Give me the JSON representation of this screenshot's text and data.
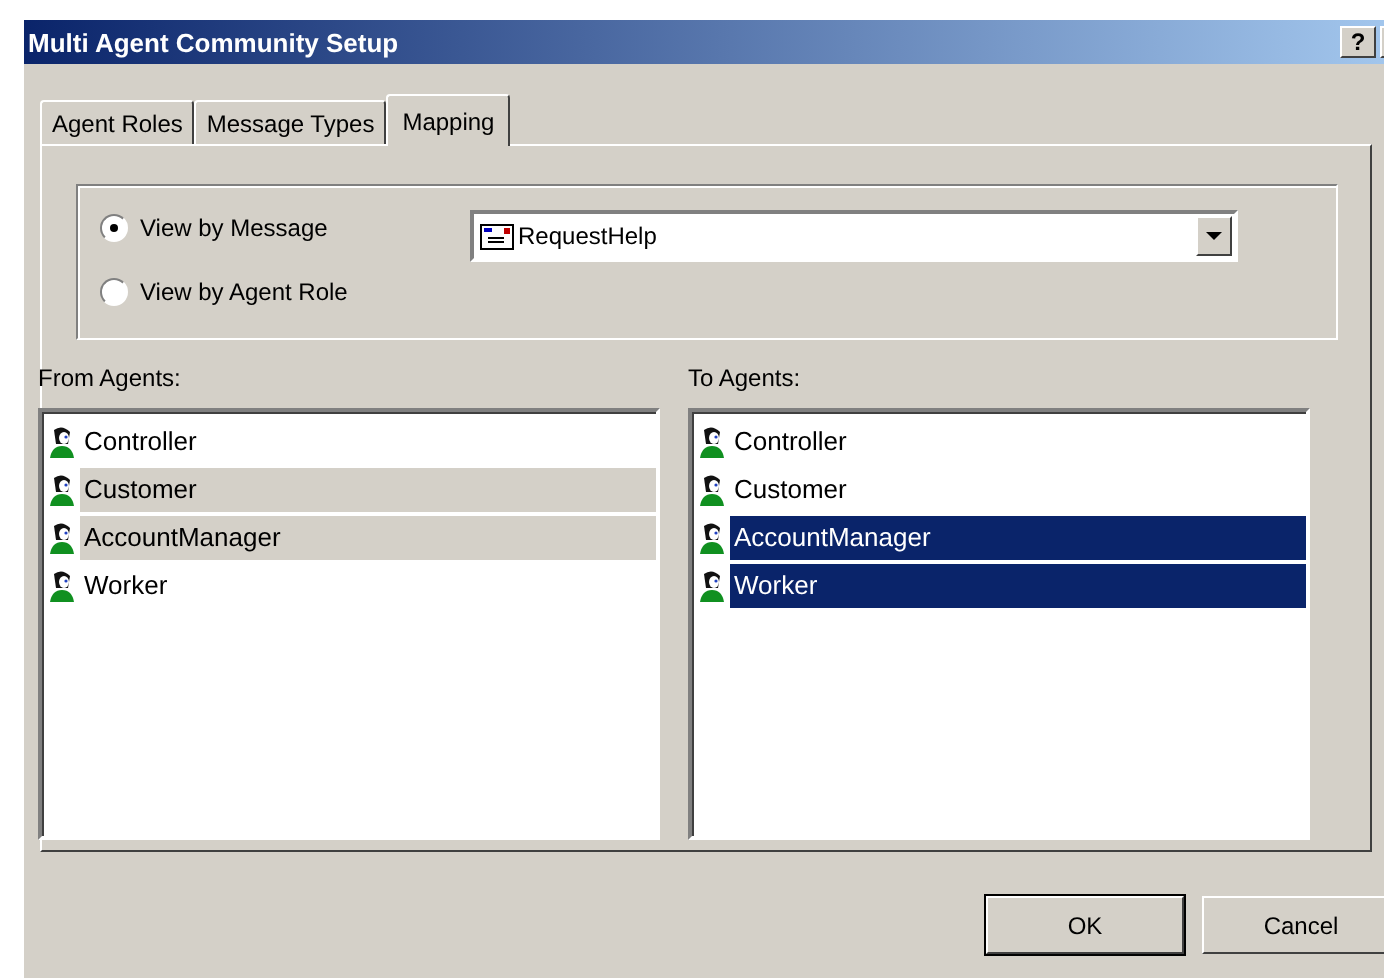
{
  "window": {
    "title": "Multi Agent Community Setup",
    "help_button": "?"
  },
  "tabs": [
    {
      "label": "Agent Roles",
      "selected": false
    },
    {
      "label": "Message Types",
      "selected": false
    },
    {
      "label": "Mapping",
      "selected": true
    }
  ],
  "view_options": [
    {
      "label": "View by Message",
      "selected": true
    },
    {
      "label": "View by Agent Role",
      "selected": false
    }
  ],
  "message_dropdown": {
    "value": "RequestHelp"
  },
  "lists": [
    {
      "label": "From Agents:",
      "focused": false,
      "items": [
        {
          "name": "Controller",
          "selected": false
        },
        {
          "name": "Customer",
          "selected": true
        },
        {
          "name": "AccountManager",
          "selected": true
        },
        {
          "name": "Worker",
          "selected": false
        }
      ]
    },
    {
      "label": "To Agents:",
      "focused": true,
      "items": [
        {
          "name": "Controller",
          "selected": false
        },
        {
          "name": "Customer",
          "selected": false
        },
        {
          "name": "AccountManager",
          "selected": true
        },
        {
          "name": "Worker",
          "selected": true
        }
      ]
    }
  ],
  "buttons": [
    {
      "label": "OK",
      "default": true
    },
    {
      "label": "Cancel",
      "default": false
    }
  ]
}
